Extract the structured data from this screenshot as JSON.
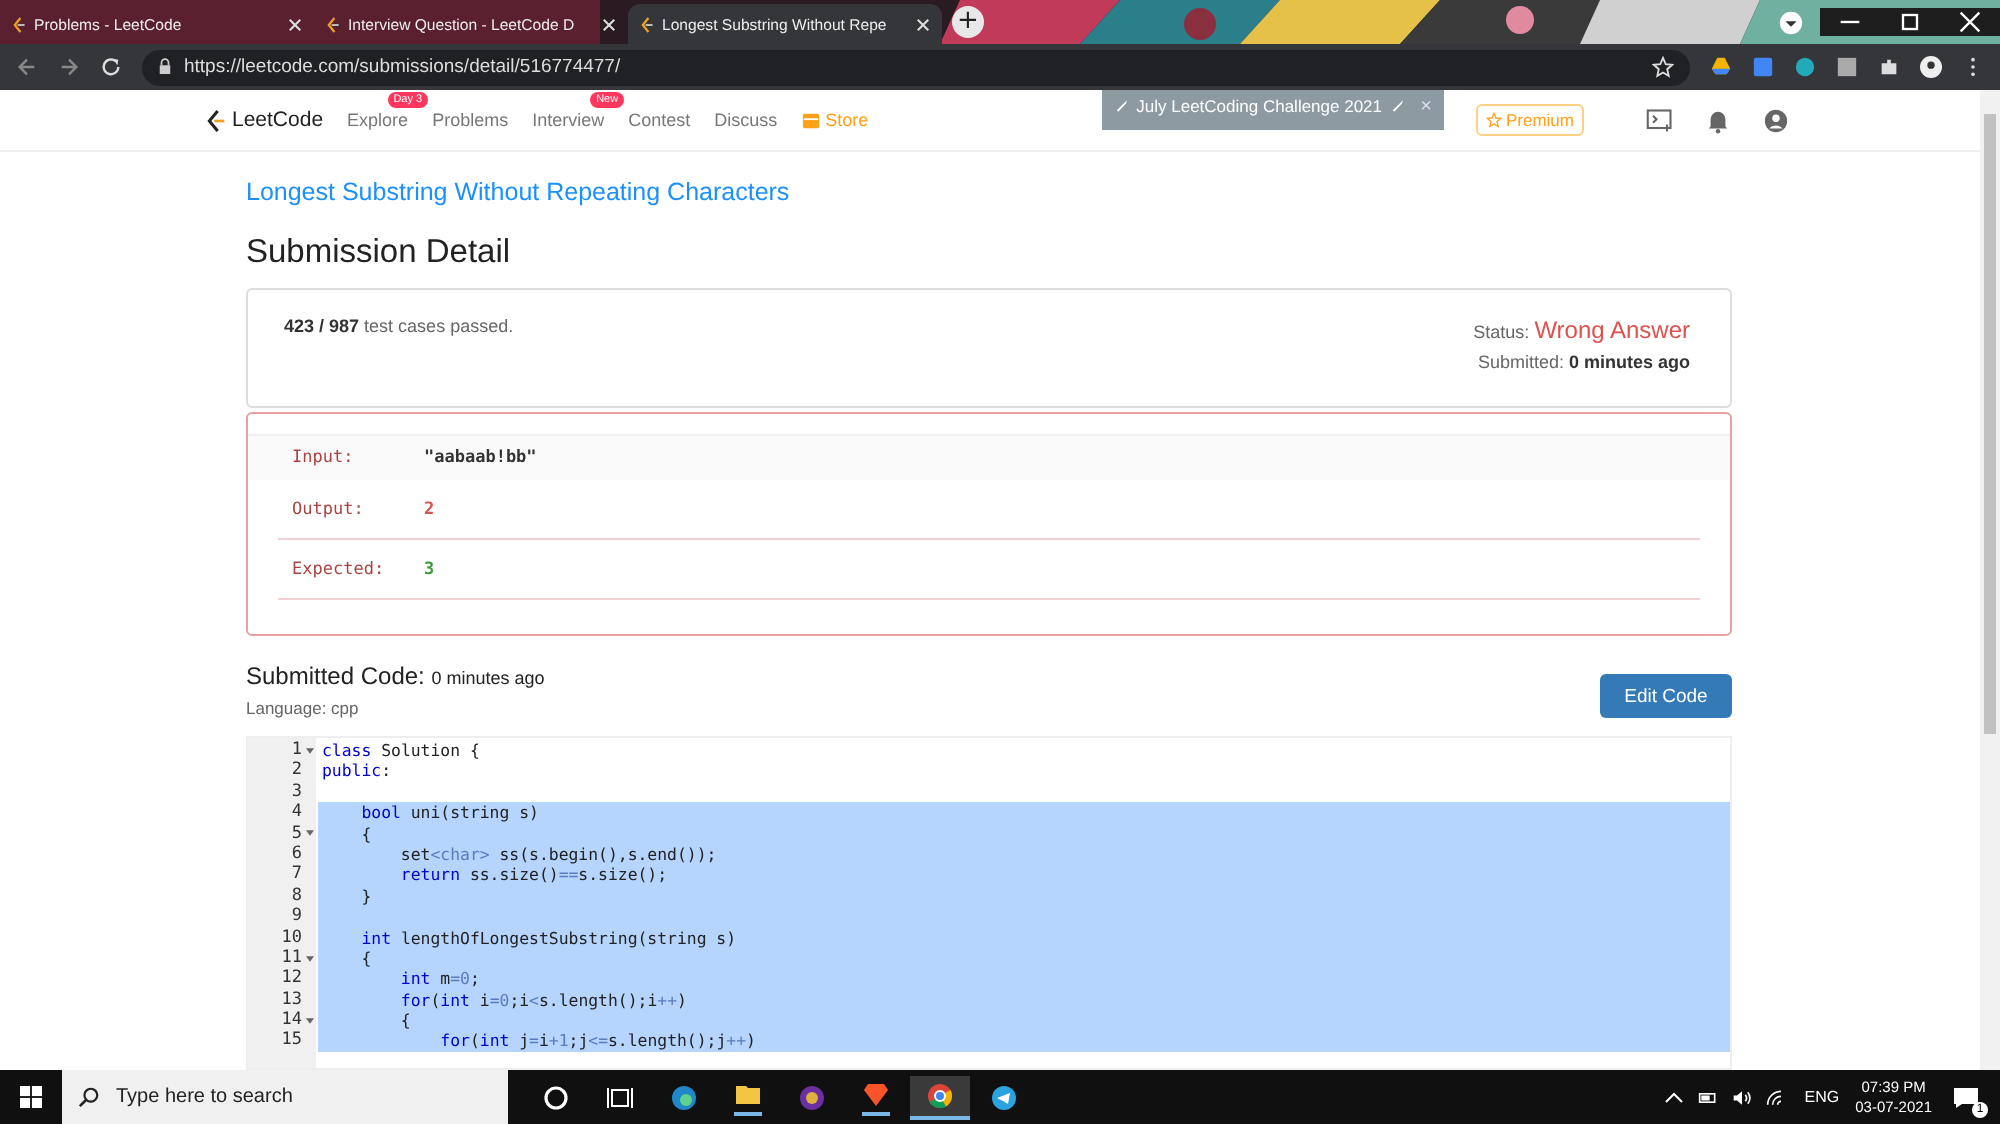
{
  "browser": {
    "tabs": [
      {
        "title": "Problems - LeetCode",
        "selected": false
      },
      {
        "title": "Interview Question - LeetCode D",
        "selected": false
      },
      {
        "title": "Longest Substring Without Repe",
        "selected": true
      }
    ],
    "new_tab": "+",
    "address": "https://leetcode.com/submissions/detail/516774477/"
  },
  "nav": {
    "logo": "LeetCode",
    "items": [
      {
        "label": "Explore",
        "badge": "Day 3",
        "kind": "link"
      },
      {
        "label": "Problems",
        "kind": "link"
      },
      {
        "label": "Interview",
        "badge": "New",
        "kind": "link"
      },
      {
        "label": "Contest",
        "kind": "link"
      },
      {
        "label": "Discuss",
        "kind": "link"
      },
      {
        "label": "Store",
        "kind": "store"
      }
    ],
    "challenge": {
      "label": "July LeetCoding Challenge 2021",
      "close": "×"
    },
    "premium": "Premium"
  },
  "problem_title": "Longest Substring Without Repeating Characters",
  "heading": "Submission Detail",
  "summary": {
    "passed": "423 / 987",
    "passed_suffix": "test cases passed.",
    "status_label": "Status:",
    "status": "Wrong Answer",
    "submitted_label": "Submitted:",
    "submitted": "0 minutes ago"
  },
  "result_rows": [
    {
      "label": "Input:",
      "value": "\"aabaab!bb\"",
      "kind": "input"
    },
    {
      "label": "Output:",
      "value": "2",
      "kind": "output"
    },
    {
      "label": "Expected:",
      "value": "3",
      "kind": "expected"
    }
  ],
  "code": {
    "heading": "Submitted Code:",
    "time": "0 minutes ago",
    "language": "Language: cpp",
    "edit_button": "Edit Code",
    "lines": [
      {
        "number": "1",
        "foldable": true,
        "selected": false,
        "segments": [
          {
            "text": "class",
            "kind": "keyword"
          },
          {
            "text": " Solution {",
            "kind": "plain"
          }
        ]
      },
      {
        "number": "2",
        "foldable": false,
        "selected": false,
        "segments": [
          {
            "text": "public",
            "kind": "keyword"
          },
          {
            "text": ":",
            "kind": "plain"
          }
        ]
      },
      {
        "number": "3",
        "foldable": false,
        "selected": false
      },
      {
        "number": "4",
        "foldable": false,
        "selected": true,
        "segments": [
          {
            "text": "    bool",
            "kind": "keyword"
          },
          {
            "text": " uni(string s)",
            "kind": "plain"
          }
        ]
      },
      {
        "number": "5",
        "foldable": true,
        "selected": true,
        "segments": [
          {
            "text": "    {",
            "kind": "plain"
          }
        ]
      },
      {
        "number": "6",
        "foldable": false,
        "selected": true,
        "segments": [
          {
            "text": "        set",
            "kind": "plain"
          },
          {
            "text": "<char>",
            "kind": "operator"
          },
          {
            "text": " ss(s.begin(),s.end());",
            "kind": "plain"
          }
        ]
      },
      {
        "number": "7",
        "foldable": false,
        "selected": true,
        "segments": [
          {
            "text": "        return",
            "kind": "keyword"
          },
          {
            "text": " ss.size()",
            "kind": "plain"
          },
          {
            "text": "==",
            "kind": "operator"
          },
          {
            "text": "s.size();",
            "kind": "plain"
          }
        ]
      },
      {
        "number": "8",
        "foldable": false,
        "selected": true,
        "segments": [
          {
            "text": "    }",
            "kind": "plain"
          }
        ]
      },
      {
        "number": "9",
        "foldable": false,
        "selected": true
      },
      {
        "number": "10",
        "foldable": false,
        "selected": true,
        "segments": [
          {
            "text": "    int",
            "kind": "keyword"
          },
          {
            "text": " lengthOfLongestSubstring(string s)",
            "kind": "plain"
          }
        ]
      },
      {
        "number": "11",
        "foldable": true,
        "selected": true,
        "segments": [
          {
            "text": "    {",
            "kind": "plain"
          }
        ]
      },
      {
        "number": "12",
        "foldable": false,
        "selected": true,
        "segments": [
          {
            "text": "        int",
            "kind": "keyword"
          },
          {
            "text": " m",
            "kind": "plain"
          },
          {
            "text": "=0",
            "kind": "operator"
          },
          {
            "text": ";",
            "kind": "plain"
          }
        ]
      },
      {
        "number": "13",
        "foldable": false,
        "selected": true,
        "segments": [
          {
            "text": "        for",
            "kind": "keyword"
          },
          {
            "text": "(",
            "kind": "plain"
          },
          {
            "text": "int",
            "kind": "keyword"
          },
          {
            "text": " i",
            "kind": "plain"
          },
          {
            "text": "=0",
            "kind": "operator"
          },
          {
            "text": ";i",
            "kind": "plain"
          },
          {
            "text": "<",
            "kind": "operator"
          },
          {
            "text": "s.length();i",
            "kind": "plain"
          },
          {
            "text": "++",
            "kind": "operator"
          },
          {
            "text": ")",
            "kind": "plain"
          }
        ]
      },
      {
        "number": "14",
        "foldable": true,
        "selected": true,
        "segments": [
          {
            "text": "        {",
            "kind": "plain"
          }
        ]
      },
      {
        "number": "15",
        "foldable": false,
        "selected": true,
        "segments": [
          {
            "text": "            for",
            "kind": "keyword"
          },
          {
            "text": "(",
            "kind": "plain"
          },
          {
            "text": "int",
            "kind": "keyword"
          },
          {
            "text": " j",
            "kind": "plain"
          },
          {
            "text": "=",
            "kind": "operator"
          },
          {
            "text": "i",
            "kind": "plain"
          },
          {
            "text": "+1",
            "kind": "operator"
          },
          {
            "text": ";j",
            "kind": "plain"
          },
          {
            "text": "<=",
            "kind": "operator"
          },
          {
            "text": "s.length();j",
            "kind": "plain"
          },
          {
            "text": "++",
            "kind": "operator"
          },
          {
            "text": ")",
            "kind": "plain"
          }
        ]
      }
    ]
  },
  "taskbar": {
    "search_placeholder": "Type here to search",
    "language": "ENG",
    "time": "07:39 PM",
    "date": "03-07-2021",
    "notifications": "1"
  }
}
